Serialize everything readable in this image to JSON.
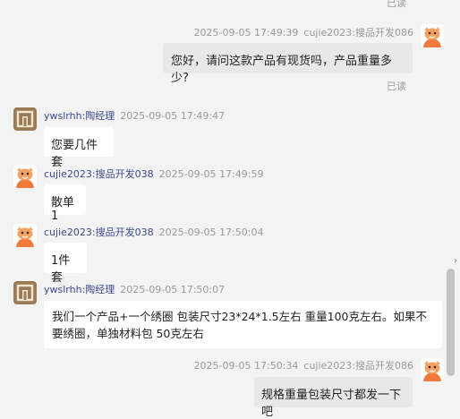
{
  "messages": [
    {
      "side": "right",
      "time": "2025-09-05 17:49:39",
      "name": "cujie2023:搜品开发086",
      "text": "您好，请问这款产品有现货吗，产品重量多少?",
      "status": "已读",
      "avatar": "buyer-avatar"
    },
    {
      "side": "left",
      "time": "2025-09-05 17:49:47",
      "name": "ywslrhh:陶经理",
      "text": "您要几件套",
      "avatar": "seller-avatar"
    },
    {
      "side": "left",
      "time": "2025-09-05 17:49:59",
      "name": "cujie2023:搜品开发038",
      "text": "散单1",
      "avatar": "buyer-avatar"
    },
    {
      "side": "left",
      "time": "2025-09-05 17:50:04",
      "name": "cujie2023:搜品开发038",
      "text": "1件套",
      "avatar": "buyer-avatar"
    },
    {
      "side": "left",
      "time": "2025-09-05 17:50:07",
      "name": "ywslrhh:陶经理",
      "text": "我们一个产品+一个绣圈 包装尺寸23*24*1.5左右 重量100克左右。如果不要绣圈，单独材料包 50克左右",
      "avatar": "seller-avatar"
    },
    {
      "side": "right",
      "time": "2025-09-05 17:50:34",
      "name": "cujie2023:搜品开发086",
      "text": "规格重量包装尺寸都发一下吧",
      "avatar": "buyer-avatar"
    }
  ],
  "top_status": "已读",
  "colors": {
    "background": "#f3f3f3",
    "name_link": "#3a4a8c",
    "buyer_avatar": "#f08a4b",
    "seller_avatar": "#9a7b55"
  }
}
